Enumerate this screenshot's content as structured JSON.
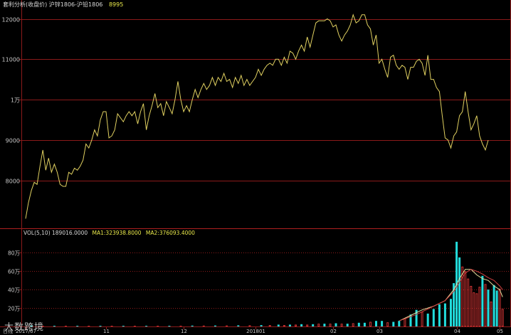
{
  "header": {
    "title": "套利分析(收盘价) 沪锌1806-沪铅1806",
    "last_value": "8995"
  },
  "volume_header": {
    "label": "VOL(5,10) 189016.0000",
    "ma1": "MA1:323938.8000",
    "ma2": "MA2:376093.4000"
  },
  "watermark": "大数跨境",
  "timeframe": "日线",
  "colors": {
    "price_line": "#e0d060",
    "up_bar": "#22dddd",
    "down_bar": "#cc3333",
    "ma1": "#e8e0a0",
    "ma2": "#d04040",
    "grid": "#8b1a1a",
    "axis_text": "#c8c8c8"
  },
  "chart_data": [
    {
      "type": "line",
      "title": "套利分析(收盘价) 沪锌1806-沪铅1806",
      "ylim": [
        7000,
        12200
      ],
      "y_ticks": [
        {
          "value": 12000,
          "label": "12000"
        },
        {
          "value": 11000,
          "label": "11000"
        },
        {
          "value": 10000,
          "label": "1万"
        },
        {
          "value": 9000,
          "label": "9000"
        },
        {
          "value": 8000,
          "label": "8000"
        }
      ],
      "values": [
        7050,
        7450,
        7750,
        7950,
        7900,
        8350,
        8750,
        8250,
        8550,
        8200,
        8400,
        8200,
        7900,
        7850,
        7850,
        8200,
        8150,
        8300,
        8250,
        8350,
        8500,
        8900,
        8800,
        9000,
        9250,
        9100,
        9500,
        9700,
        9700,
        9050,
        9100,
        9250,
        9650,
        9550,
        9450,
        9600,
        9700,
        9600,
        9700,
        9400,
        9700,
        9900,
        9250,
        9600,
        9850,
        10150,
        9800,
        9900,
        9600,
        9950,
        9800,
        9650,
        10000,
        10450,
        10000,
        9700,
        9850,
        9700,
        10000,
        10250,
        10050,
        10250,
        10400,
        10250,
        10350,
        10550,
        10350,
        10550,
        10450,
        10650,
        10450,
        10500,
        10300,
        10550,
        10400,
        10600,
        10350,
        10500,
        10350,
        10450,
        10550,
        10750,
        10600,
        10750,
        10850,
        10900,
        10850,
        11000,
        11000,
        10850,
        11050,
        10900,
        11200,
        11150,
        11000,
        11200,
        11350,
        11200,
        11550,
        11300,
        11600,
        11900,
        11950,
        11950,
        11950,
        12000,
        11950,
        11800,
        11850,
        11600,
        11450,
        11600,
        11700,
        11850,
        12100,
        11900,
        11950,
        12100,
        12100,
        11850,
        11750,
        11350,
        11600,
        10900,
        11000,
        10750,
        10550,
        11050,
        11100,
        10850,
        10750,
        10850,
        10800,
        10500,
        10800,
        10800,
        10950,
        11000,
        10900,
        10600,
        11100,
        10500,
        10500,
        10300,
        10200,
        9600,
        9050,
        9000,
        8800,
        9100,
        9200,
        9600,
        9700,
        10200,
        9700,
        9250,
        9400,
        9600,
        9100,
        8900,
        8750,
        8995
      ],
      "x_ticks": [
        {
          "index": 0,
          "label": "2017/07"
        },
        {
          "index": 28,
          "label": "11"
        },
        {
          "index": 55,
          "label": "12"
        },
        {
          "index": 80,
          "label": "201801"
        },
        {
          "index": 107,
          "label": "02"
        },
        {
          "index": 123,
          "label": "03"
        },
        {
          "index": 150,
          "label": "04"
        },
        {
          "index": 165,
          "label": "05"
        }
      ]
    },
    {
      "type": "bar",
      "title": "VOL(5,10)",
      "ylim": [
        0,
        95
      ],
      "y_ticks": [
        {
          "value": 80,
          "label": "80万"
        },
        {
          "value": 60,
          "label": "60万"
        },
        {
          "value": 40,
          "label": "40万"
        },
        {
          "value": 20,
          "label": "20万"
        }
      ],
      "bars": [
        {
          "x": 2,
          "v": 0.5,
          "up": true
        },
        {
          "x": 6,
          "v": 0.5,
          "up": false
        },
        {
          "x": 10,
          "v": 0.6,
          "up": true
        },
        {
          "x": 14,
          "v": 0.5,
          "up": false
        },
        {
          "x": 18,
          "v": 0.6,
          "up": true
        },
        {
          "x": 22,
          "v": 0.5,
          "up": false
        },
        {
          "x": 26,
          "v": 0.6,
          "up": true
        },
        {
          "x": 30,
          "v": 0.6,
          "up": false
        },
        {
          "x": 34,
          "v": 0.7,
          "up": true
        },
        {
          "x": 38,
          "v": 0.6,
          "up": false
        },
        {
          "x": 42,
          "v": 0.7,
          "up": true
        },
        {
          "x": 46,
          "v": 0.7,
          "up": false
        },
        {
          "x": 50,
          "v": 0.8,
          "up": true
        },
        {
          "x": 54,
          "v": 0.8,
          "up": false
        },
        {
          "x": 58,
          "v": 0.9,
          "up": true
        },
        {
          "x": 62,
          "v": 0.9,
          "up": false
        },
        {
          "x": 66,
          "v": 1,
          "up": true
        },
        {
          "x": 70,
          "v": 1,
          "up": false
        },
        {
          "x": 74,
          "v": 1.2,
          "up": true
        },
        {
          "x": 78,
          "v": 1.2,
          "up": false
        },
        {
          "x": 82,
          "v": 1.5,
          "up": true
        },
        {
          "x": 85,
          "v": 1.5,
          "up": false
        },
        {
          "x": 88,
          "v": 2,
          "up": true
        },
        {
          "x": 90,
          "v": 1.5,
          "up": false
        },
        {
          "x": 92,
          "v": 2,
          "up": true
        },
        {
          "x": 94,
          "v": 2,
          "up": false
        },
        {
          "x": 96,
          "v": 2.5,
          "up": true
        },
        {
          "x": 98,
          "v": 2,
          "up": false
        },
        {
          "x": 100,
          "v": 2.5,
          "up": true
        },
        {
          "x": 102,
          "v": 3,
          "up": false
        },
        {
          "x": 104,
          "v": 3,
          "up": true
        },
        {
          "x": 106,
          "v": 3,
          "up": false
        },
        {
          "x": 108,
          "v": 3.5,
          "up": true
        },
        {
          "x": 110,
          "v": 3,
          "up": false
        },
        {
          "x": 112,
          "v": 3,
          "up": true
        },
        {
          "x": 114,
          "v": 3.5,
          "up": false
        },
        {
          "x": 116,
          "v": 4,
          "up": true
        },
        {
          "x": 118,
          "v": 4,
          "up": true
        },
        {
          "x": 120,
          "v": 5,
          "up": false
        },
        {
          "x": 122,
          "v": 6,
          "up": true
        },
        {
          "x": 124,
          "v": 6,
          "up": true
        },
        {
          "x": 126,
          "v": 4.5,
          "up": false
        },
        {
          "x": 128,
          "v": 5,
          "up": true
        },
        {
          "x": 130,
          "v": 6,
          "up": true
        },
        {
          "x": 132,
          "v": 9,
          "up": false
        },
        {
          "x": 134,
          "v": 13,
          "up": true
        },
        {
          "x": 136,
          "v": 18,
          "up": true
        },
        {
          "x": 138,
          "v": 16,
          "up": false
        },
        {
          "x": 140,
          "v": 14,
          "up": true
        },
        {
          "x": 142,
          "v": 19,
          "up": true
        },
        {
          "x": 144,
          "v": 24,
          "up": true
        },
        {
          "x": 146,
          "v": 25,
          "up": true
        },
        {
          "x": 148,
          "v": 30,
          "up": true
        },
        {
          "x": 149,
          "v": 47,
          "up": true
        },
        {
          "x": 150,
          "v": 92,
          "up": true
        },
        {
          "x": 151,
          "v": 75,
          "up": true
        },
        {
          "x": 152,
          "v": 65,
          "up": false
        },
        {
          "x": 153,
          "v": 60,
          "up": false
        },
        {
          "x": 154,
          "v": 52,
          "up": false
        },
        {
          "x": 155,
          "v": 44,
          "up": false
        },
        {
          "x": 156,
          "v": 37,
          "up": false
        },
        {
          "x": 157,
          "v": 36,
          "up": false
        },
        {
          "x": 158,
          "v": 43,
          "up": false
        },
        {
          "x": 159,
          "v": 55,
          "up": true
        },
        {
          "x": 160,
          "v": 46,
          "up": false
        },
        {
          "x": 161,
          "v": 40,
          "up": true
        },
        {
          "x": 162,
          "v": 27,
          "up": false
        },
        {
          "x": 163,
          "v": 45,
          "up": true
        },
        {
          "x": 164,
          "v": 39,
          "up": true
        },
        {
          "x": 165,
          "v": 41,
          "up": false
        },
        {
          "x": 166,
          "v": 19,
          "up": false
        }
      ],
      "ma1": [
        [
          130,
          6
        ],
        [
          134,
          12
        ],
        [
          138,
          18
        ],
        [
          142,
          22
        ],
        [
          146,
          28
        ],
        [
          149,
          40
        ],
        [
          151,
          52
        ],
        [
          153,
          62
        ],
        [
          155,
          62
        ],
        [
          157,
          56
        ],
        [
          159,
          52
        ],
        [
          161,
          50
        ],
        [
          163,
          44
        ],
        [
          165,
          40
        ],
        [
          166,
          32
        ]
      ],
      "ma2": [
        [
          130,
          6
        ],
        [
          136,
          13
        ],
        [
          142,
          22
        ],
        [
          146,
          28
        ],
        [
          149,
          38
        ],
        [
          151,
          48
        ],
        [
          153,
          58
        ],
        [
          155,
          62
        ],
        [
          157,
          60
        ],
        [
          159,
          57
        ],
        [
          161,
          53
        ],
        [
          163,
          50
        ],
        [
          165,
          44
        ],
        [
          166,
          40
        ]
      ]
    }
  ]
}
